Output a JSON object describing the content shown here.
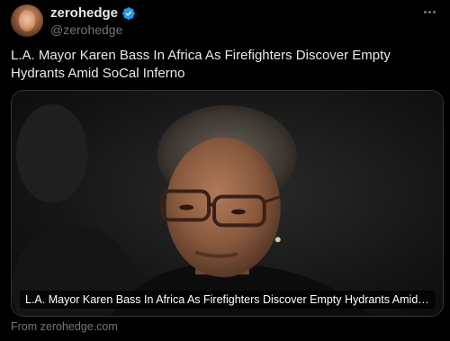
{
  "author": {
    "display_name": "zerohedge",
    "handle": "@zerohedge",
    "verified": true,
    "verified_color": "#1d9bf0"
  },
  "post": {
    "text": "L.A. Mayor Karen Bass In Africa As Firefighters Discover Empty Hydrants Amid SoCal Inferno"
  },
  "link_card": {
    "title": "L.A. Mayor Karen Bass In Africa As Firefighters Discover Empty Hydrants Amid SoCal In...",
    "image": "photo of a woman with short curly hair and glasses against a dark background"
  },
  "footer": {
    "source": "From zerohedge.com"
  },
  "icons": [
    "verified-badge-icon",
    "more-options-icon"
  ],
  "colors": {
    "background": "#000000",
    "text_primary": "#e7e9ea",
    "text_secondary": "#71767b",
    "border": "#2f3336"
  }
}
